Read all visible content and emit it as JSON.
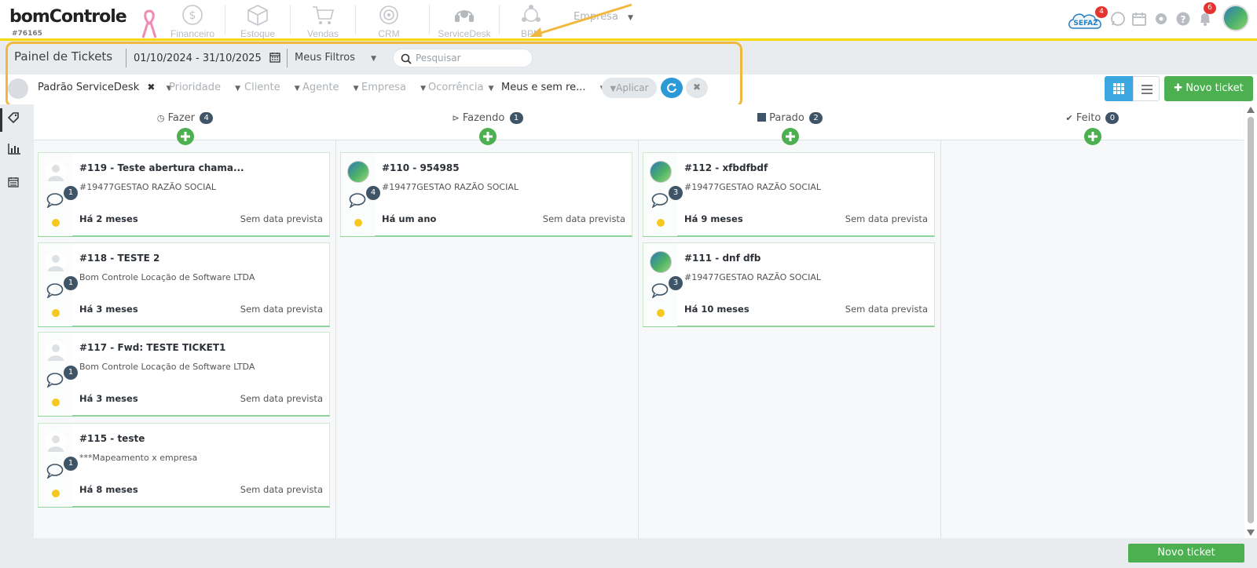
{
  "header": {
    "logo_text": "bomControle",
    "account_id": "#76165",
    "nav": [
      {
        "label": "Financeiro",
        "icon": "dollar-coin-icon"
      },
      {
        "label": "Estoque",
        "icon": "box-icon"
      },
      {
        "label": "Vendas",
        "icon": "cart-icon"
      },
      {
        "label": "CRM",
        "icon": "target-icon"
      },
      {
        "label": "ServiceDesk",
        "icon": "headset-icon"
      },
      {
        "label": "BPM",
        "icon": "network-icon"
      }
    ],
    "empresa_label": "Empresa",
    "sefaz_label": "SEFAZ",
    "sefaz_badge": "4",
    "notifications_badge": "6"
  },
  "toolbar": {
    "title": "Painel de Tickets",
    "date_range": "01/10/2024 - 31/10/2025",
    "filters_label": "Meus Filtros",
    "search_placeholder": "Pesquisar",
    "filter_items": [
      {
        "label": "Padrão ServiceDesk"
      },
      {
        "label": "Prioridade"
      },
      {
        "label": "Cliente"
      },
      {
        "label": "Agente"
      },
      {
        "label": "Empresa"
      },
      {
        "label": "Ocorrência"
      },
      {
        "label": "Meus e sem re..."
      }
    ],
    "apply_label": "Aplicar",
    "new_ticket_label": "Novo ticket"
  },
  "columns": [
    {
      "title": "Fazer",
      "count": "4",
      "icon": "clock-icon"
    },
    {
      "title": "Fazendo",
      "count": "1",
      "icon": "play-circle-icon"
    },
    {
      "title": "Parado",
      "count": "2",
      "icon": "stop-square-icon"
    },
    {
      "title": "Feito",
      "count": "0",
      "icon": "check-icon"
    }
  ],
  "cards": {
    "fazer": [
      {
        "title": "#119 - Teste abertura chama...",
        "subtitle": "#19477GESTAO RAZÃO SOCIAL",
        "comments": "1",
        "age": "Há 2 meses",
        "due": "Sem data prevista"
      },
      {
        "title": "#118 - TESTE 2",
        "subtitle": "Bom Controle Locação de Software LTDA",
        "comments": "1",
        "age": "Há 3 meses",
        "due": "Sem data prevista"
      },
      {
        "title": "#117 - Fwd: TESTE TICKET1",
        "subtitle": "Bom Controle Locação de Software LTDA",
        "comments": "1",
        "age": "Há 3 meses",
        "due": "Sem data prevista"
      },
      {
        "title": "#115 - teste",
        "subtitle": "***Mapeamento x empresa",
        "comments": "1",
        "age": "Há 8 meses",
        "due": "Sem data prevista"
      }
    ],
    "fazendo": [
      {
        "title": "#110 - 954985",
        "subtitle": "#19477GESTAO RAZÃO SOCIAL",
        "comments": "4",
        "age": "Há um ano",
        "due": "Sem data prevista"
      }
    ],
    "parado": [
      {
        "title": "#112 - xfbdfbdf",
        "subtitle": "#19477GESTAO RAZÃO SOCIAL",
        "comments": "3",
        "age": "Há 9 meses",
        "due": "Sem data prevista"
      },
      {
        "title": "#111 - dnf dfb",
        "subtitle": "#19477GESTAO RAZÃO SOCIAL",
        "comments": "3",
        "age": "Há 10 meses",
        "due": "Sem data prevista"
      }
    ]
  },
  "footer": {
    "new_ticket_label": "Novo ticket"
  },
  "colors": {
    "accent_yellow": "#f5d90a",
    "highlight": "#f0b93d",
    "green": "#4cb050",
    "blue": "#2b9ad6",
    "badge_dark": "#3f5567",
    "badge_red": "#e3342f"
  }
}
